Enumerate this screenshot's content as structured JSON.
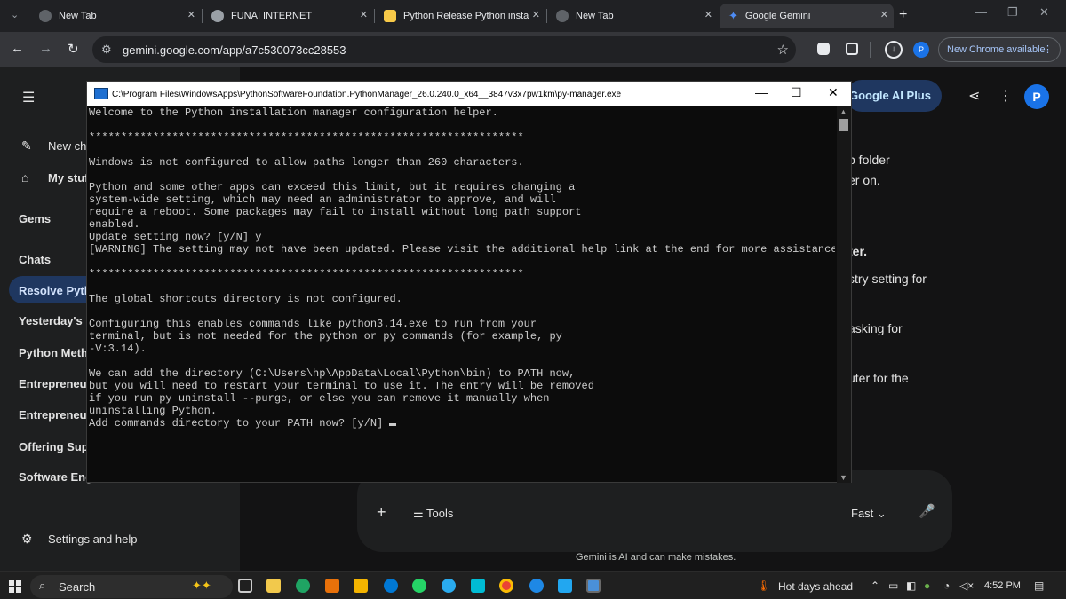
{
  "browser": {
    "tabs": [
      {
        "title": "New Tab"
      },
      {
        "title": "FUNAI INTERNET"
      },
      {
        "title": "Python Release Python insta"
      },
      {
        "title": "New Tab"
      },
      {
        "title": "Google Gemini"
      }
    ],
    "url": "gemini.google.com/app/a7c530073cc28553",
    "profile_initial": "P",
    "new_chrome": "New Chrome available"
  },
  "gemini": {
    "sidebar": {
      "new_chat": "New ch",
      "my_stuff": "My stuf",
      "gems": "Gems",
      "chats": "Chats",
      "items": [
        "Resolve Pyth",
        "Yesterday's B",
        "Python Meth",
        "Entrepreneur",
        "Entrepreneur",
        "Offering Supp",
        "Software Eng"
      ],
      "settings": "Settings and help"
    },
    "ai_plus": "Google AI Plus",
    "avatar_initial": "P",
    "response_fragments": [
      "p folder",
      "er on.",
      "ter.",
      "stry setting for",
      "asking for",
      "uter for the"
    ],
    "input": {
      "tools": "Tools",
      "mode": "Fast"
    },
    "disclaimer": "Gemini is AI and can make mistakes."
  },
  "terminal": {
    "title": "C:\\Program Files\\WindowsApps\\PythonSoftwareFoundation.PythonManager_26.0.240.0_x64__3847v3x7pw1km\\py-manager.exe",
    "lines": [
      "Welcome to the Python installation manager configuration helper.",
      "",
      "********************************************************************",
      "",
      "Windows is not configured to allow paths longer than 260 characters.",
      "",
      "Python and some other apps can exceed this limit, but it requires changing a",
      "system-wide setting, which may need an administrator to approve, and will",
      "require a reboot. Some packages may fail to install without long path support",
      "enabled.",
      "Update setting now? [y/N] y",
      "[WARNING] The setting may not have been updated. Please visit the additional help link at the end for more assistance.",
      "",
      "********************************************************************",
      "",
      "The global shortcuts directory is not configured.",
      "",
      "Configuring this enables commands like python3.14.exe to run from your",
      "terminal, but is not needed for the python or py commands (for example, py",
      "-V:3.14).",
      "",
      "We can add the directory (C:\\Users\\hp\\AppData\\Local\\Python\\bin) to PATH now,",
      "but you will need to restart your terminal to use it. The entry will be removed",
      "if you run py uninstall --purge, or else you can remove it manually when",
      "uninstalling Python."
    ],
    "prompt": "Add commands directory to your PATH now? [y/N] "
  },
  "taskbar": {
    "search": "Search",
    "weather": "Hot days ahead",
    "time": "4:52 PM"
  }
}
